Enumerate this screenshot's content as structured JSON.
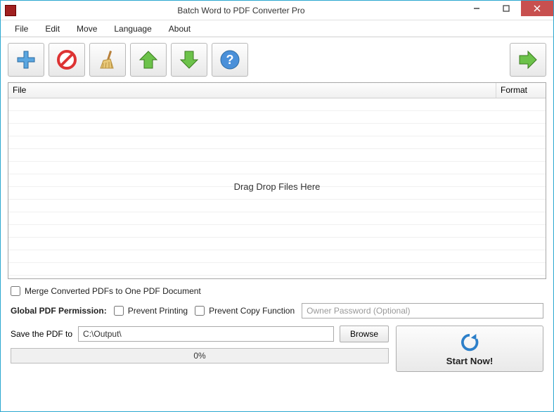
{
  "window": {
    "title": "Batch Word to PDF Converter Pro"
  },
  "menu": {
    "file": "File",
    "edit": "Edit",
    "move": "Move",
    "language": "Language",
    "about": "About"
  },
  "filelist": {
    "col_file": "File",
    "col_format": "Format",
    "drop_hint": "Drag  Drop Files Here"
  },
  "options": {
    "merge_label": "Merge Converted PDFs to One PDF Document",
    "permission_label": "Global PDF Permission:",
    "prevent_printing": "Prevent Printing",
    "prevent_copy": "Prevent Copy Function",
    "owner_password_placeholder": "Owner Password (Optional)"
  },
  "output": {
    "save_label": "Save the PDF to",
    "path": "C:\\Output\\",
    "browse": "Browse",
    "progress_text": "0%",
    "start": "Start Now!"
  }
}
